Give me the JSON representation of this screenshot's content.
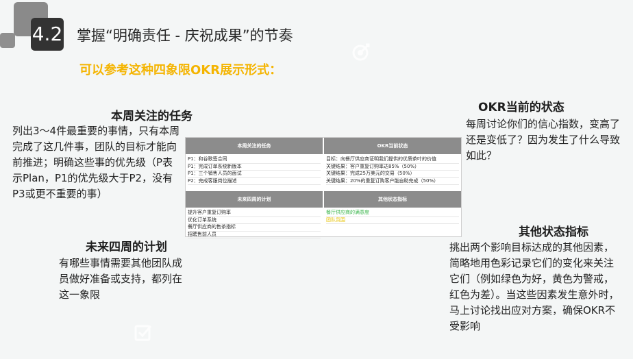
{
  "slide": {
    "number": "4.2",
    "title": "掌握“明确责任 - 庆祝成果”的节奏",
    "subtitle": "可以参考这种四象限OKR展示形式："
  },
  "quadrants": {
    "tasks": {
      "heading": "本周关注的任务",
      "text": "列出3～4件最重要的事情，只有本周完成了这几件事，团队的目标才能向前推进；明确这些事的优先级（P表示Plan，P1的优先级大于P2，没有P3或更不重要的事）"
    },
    "okr_status": {
      "heading": "OKR当前的状态",
      "text": "每周讨论你们的信心指数，变高了还是变低了？因为发生了什么导致如此？"
    },
    "plan": {
      "heading": "未来四周的计划",
      "text": "有哪些事情需要其他团队成员做好准备或支持，都列在这一象限"
    },
    "other": {
      "heading": "其他状态指标",
      "text": "挑出两个影响目标达成的其他因素，简略地用色彩记录它们的变化来关注它们（例如绿色为好，黄色为警戒，红色为差）。当这些因素发生意外时，马上讨论找出应对方案，确保OKR不受影响"
    }
  },
  "table": {
    "headers": [
      "本周关注的任务",
      "OKR当前状态",
      "未来四周的计划",
      "其他状态指标"
    ],
    "tasks": [
      "P1：和谷歌签合同",
      "P1：完成订单系统新版本",
      "P1：三个销售人员的面试",
      "P2：完成客服岗位描述"
    ],
    "okr": [
      "目标：向餐厅供应商证明我们提供的优质茶叶的价值",
      "关键结果：客户重复订购率达85%（50%）",
      "关键结果：完成25万美元的交易（50%）",
      "关键结果：20%的重复订购客户能自助完成（50%）"
    ],
    "plan": [
      "提升客户重复订购率",
      "优化订单系统",
      "餐厅供应商的售茶指标",
      "招聘售前人员"
    ],
    "other": [
      "餐厅供应商的满意度",
      "团队氛围"
    ]
  },
  "colors": {
    "accent_yellow": "#f4b400",
    "badge_bg": "#333333",
    "table_header": "#8c8c8c",
    "good": "#38b44a",
    "warning": "#e6c200"
  }
}
